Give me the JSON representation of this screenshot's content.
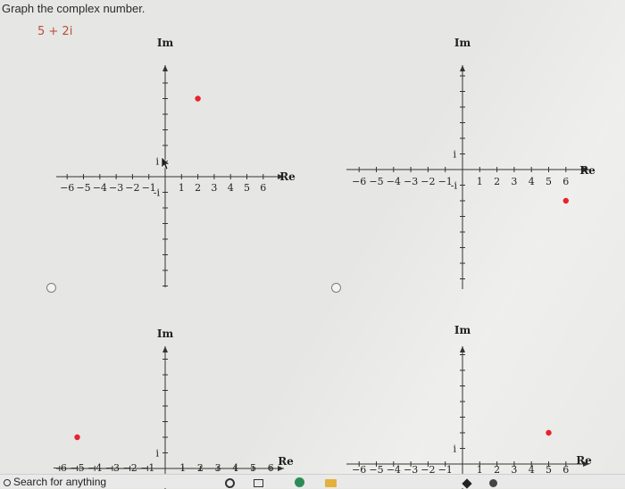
{
  "question": {
    "instruction": "Graph the complex number.",
    "expression": "5 + 2i"
  },
  "graph_labels": {
    "imag_axis": "Im",
    "real_axis": "Re",
    "unit_up": "i",
    "unit_down": "-i"
  },
  "tick_labels": [
    "−6",
    "−5",
    "−4",
    "−3",
    "−2",
    "−1",
    "1",
    "2",
    "3",
    "4",
    "5",
    "6"
  ],
  "options": [
    {
      "id": "A",
      "point": [
        2,
        5
      ],
      "selected": false
    },
    {
      "id": "B",
      "point": [
        6,
        -2
      ],
      "selected": false
    },
    {
      "id": "C",
      "point": [
        -5,
        2
      ],
      "selected": false
    },
    {
      "id": "D",
      "point": [
        5,
        2
      ],
      "selected": false
    }
  ],
  "colors": {
    "point": "#e8232e",
    "axis": "#333333"
  },
  "taskbar": {
    "search_placeholder": "Search for anything",
    "icons": [
      "cortana-icon",
      "task-view-icon",
      "edge-icon",
      "file-explorer-icon"
    ]
  }
}
